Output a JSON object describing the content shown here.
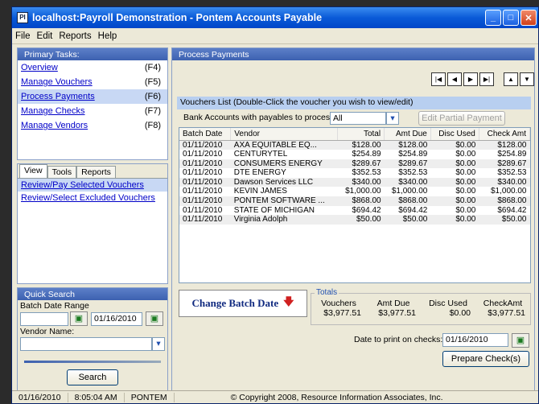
{
  "window": {
    "title": "localhost:Payroll Demonstration - Pontem Accounts Payable",
    "app_icon_label": "PI"
  },
  "menu": [
    "File",
    "Edit",
    "Reports",
    "Help"
  ],
  "primary_tasks": {
    "header": "Primary Tasks:",
    "items": [
      {
        "label": "Overview",
        "key": "(F4)"
      },
      {
        "label": "Manage Vouchers",
        "key": "(F5)"
      },
      {
        "label": "Process Payments",
        "key": "(F6)"
      },
      {
        "label": "Manage Checks",
        "key": "(F7)"
      },
      {
        "label": "Manage Vendors",
        "key": "(F8)"
      }
    ]
  },
  "tabs": {
    "items": [
      "View",
      "Tools",
      "Reports"
    ],
    "links": [
      "Review/Pay Selected Vouchers",
      "Review/Select Excluded Vouchers"
    ]
  },
  "quick_search": {
    "header": "Quick Search",
    "batch_date_label": "Batch Date Range",
    "from_date": "",
    "to_date": "01/16/2010",
    "vendor_label": "Vendor Name:",
    "vendor_value": "",
    "search_label": "Search"
  },
  "main": {
    "header": "Process Payments",
    "vouchers_label": "Vouchers List (Double-Click the voucher you wish to view/edit)",
    "bank_label": "Bank Accounts with payables to process:",
    "bank_value": "All",
    "edit_partial_label": "Edit Partial Payment",
    "columns": [
      "Batch Date",
      "Vendor",
      "Total",
      "Amt Due",
      "Disc Used",
      "Check Amt"
    ],
    "rows": [
      [
        "01/11/2010",
        "AXA EQUITABLE EQ...",
        "$128.00",
        "$128.00",
        "$0.00",
        "$128.00"
      ],
      [
        "01/11/2010",
        "CENTURYTEL",
        "$254.89",
        "$254.89",
        "$0.00",
        "$254.89"
      ],
      [
        "01/11/2010",
        "CONSUMERS ENERGY",
        "$289.67",
        "$289.67",
        "$0.00",
        "$289.67"
      ],
      [
        "01/11/2010",
        "DTE ENERGY",
        "$352.53",
        "$352.53",
        "$0.00",
        "$352.53"
      ],
      [
        "01/11/2010",
        "Dawson Services LLC",
        "$340.00",
        "$340.00",
        "$0.00",
        "$340.00"
      ],
      [
        "01/11/2010",
        "KEVIN JAMES",
        "$1,000.00",
        "$1,000.00",
        "$0.00",
        "$1,000.00"
      ],
      [
        "01/11/2010",
        "PONTEM SOFTWARE ...",
        "$868.00",
        "$868.00",
        "$0.00",
        "$868.00"
      ],
      [
        "01/11/2010",
        "STATE OF MICHIGAN",
        "$694.42",
        "$694.42",
        "$0.00",
        "$694.42"
      ],
      [
        "01/11/2010",
        "Virginia Adolph",
        "$50.00",
        "$50.00",
        "$0.00",
        "$50.00"
      ]
    ],
    "change_batch_label": "Change Batch Date",
    "totals": {
      "legend": "Totals",
      "headers": [
        "Vouchers",
        "Amt Due",
        "Disc Used",
        "CheckAmt"
      ],
      "values": [
        "$3,977.51",
        "$3,977.51",
        "$0.00",
        "$3,977.51"
      ]
    },
    "date_to_print_label": "Date to print on checks:",
    "date_to_print_value": "01/16/2010",
    "prepare_label": "Prepare Check(s)"
  },
  "status": {
    "date": "01/16/2010",
    "time": "8:05:04 AM",
    "user": "PONTEM",
    "copyright": "© Copyright 2008, Resource Information Associates, Inc."
  },
  "colors": {
    "accent": "#0a5ad8",
    "link": "#0000c8",
    "panel_header": "#3d61b0"
  }
}
